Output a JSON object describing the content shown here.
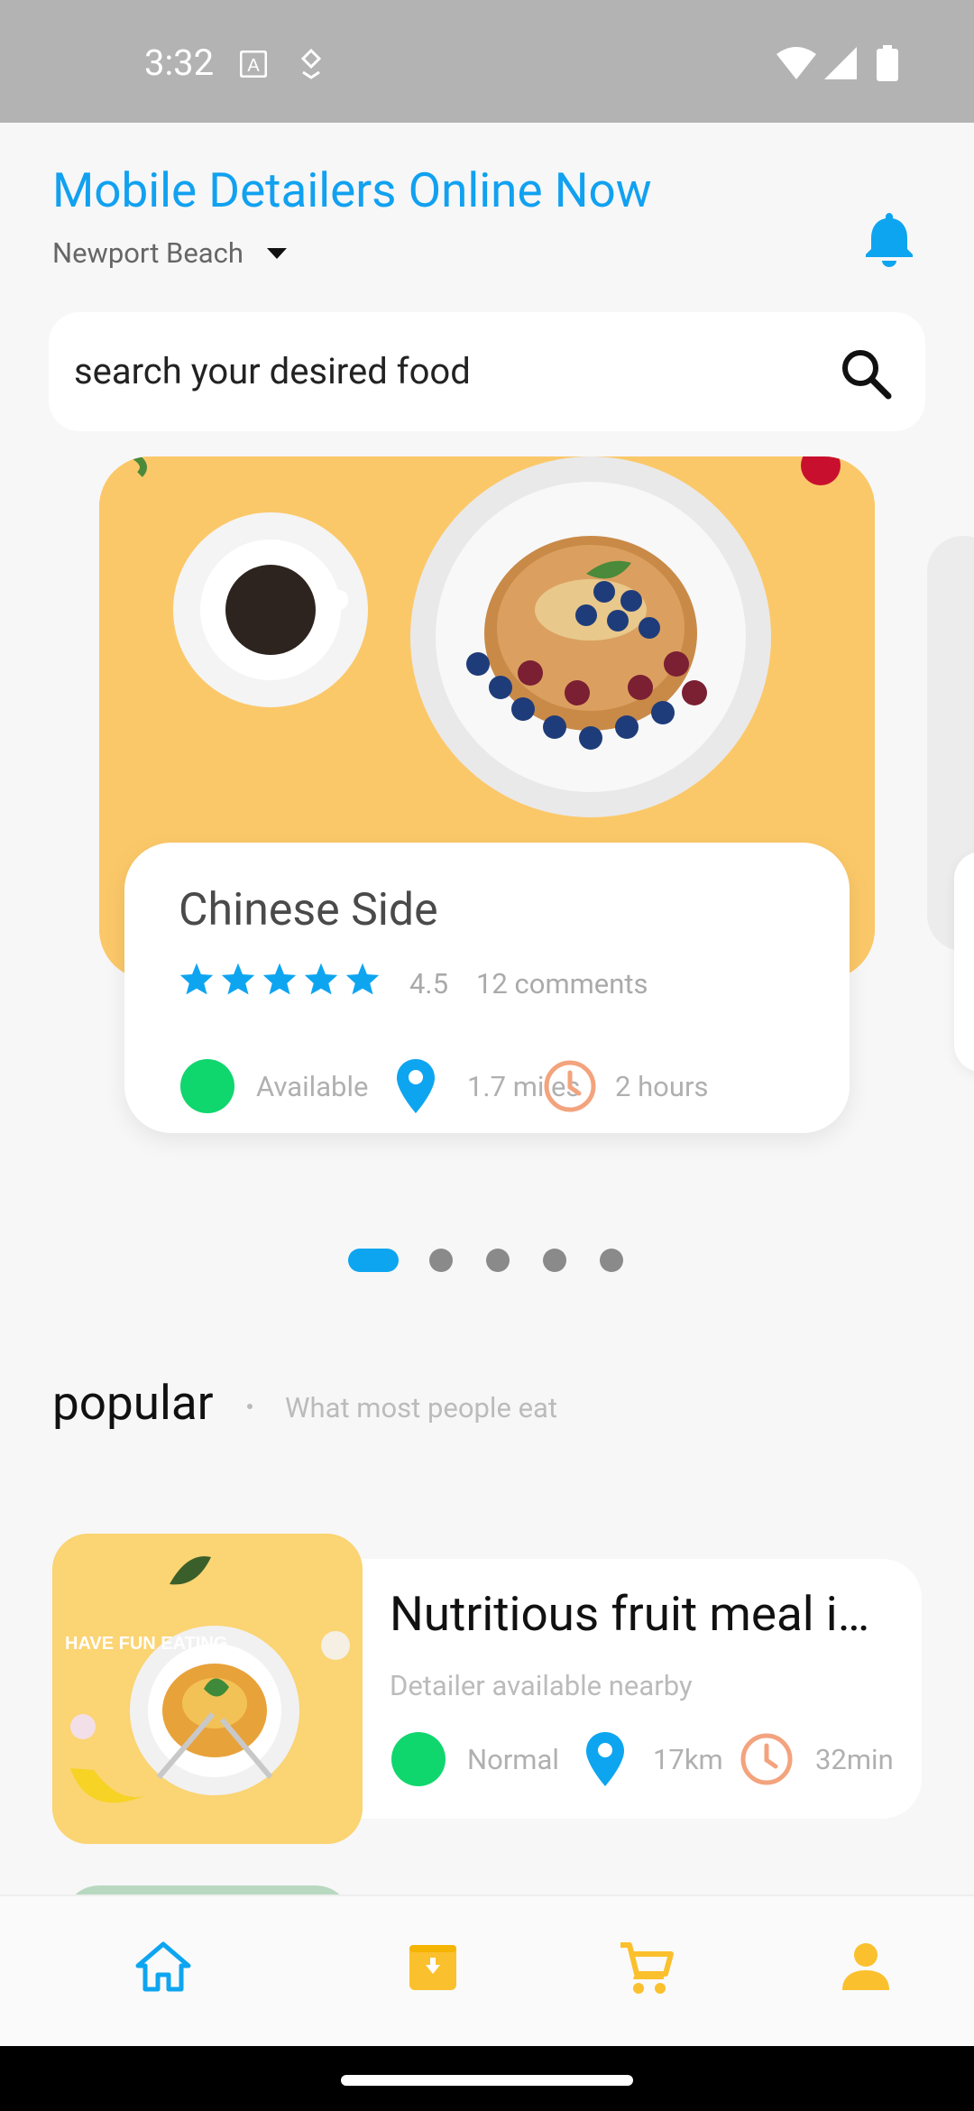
{
  "status_bar": {
    "time": "3:32"
  },
  "header": {
    "title": "Mobile Detailers Online Now",
    "location": "Newport Beach"
  },
  "search": {
    "placeholder": "search your desired food"
  },
  "carousel": {
    "card": {
      "title": "Chinese Side",
      "rating": "4.5",
      "stars": 5,
      "comments": "12 comments",
      "availability": "Available",
      "distance": "1.7 miles",
      "duration": "2 hours"
    },
    "page_count": 5,
    "active_page": 1
  },
  "popular": {
    "title": "popular",
    "subtitle": "What most people eat",
    "items": [
      {
        "title": "Nutritious fruit meal i…",
        "subtitle": "Detailer available nearby",
        "status": "Normal",
        "distance": "17km",
        "time": "32min",
        "image_text": "HAVE FUN EATING"
      }
    ]
  },
  "bottom_nav": {
    "items": [
      {
        "icon": "home-icon",
        "active": true
      },
      {
        "icon": "archive-icon",
        "active": false
      },
      {
        "icon": "cart-icon",
        "active": false
      },
      {
        "icon": "person-icon",
        "active": false
      }
    ]
  },
  "colors": {
    "accent": "#0ea5f0",
    "star": "#0ea5f0",
    "available": "#10d66e",
    "clock": "#f3a37d",
    "nav_inactive": "#fbc02d"
  }
}
